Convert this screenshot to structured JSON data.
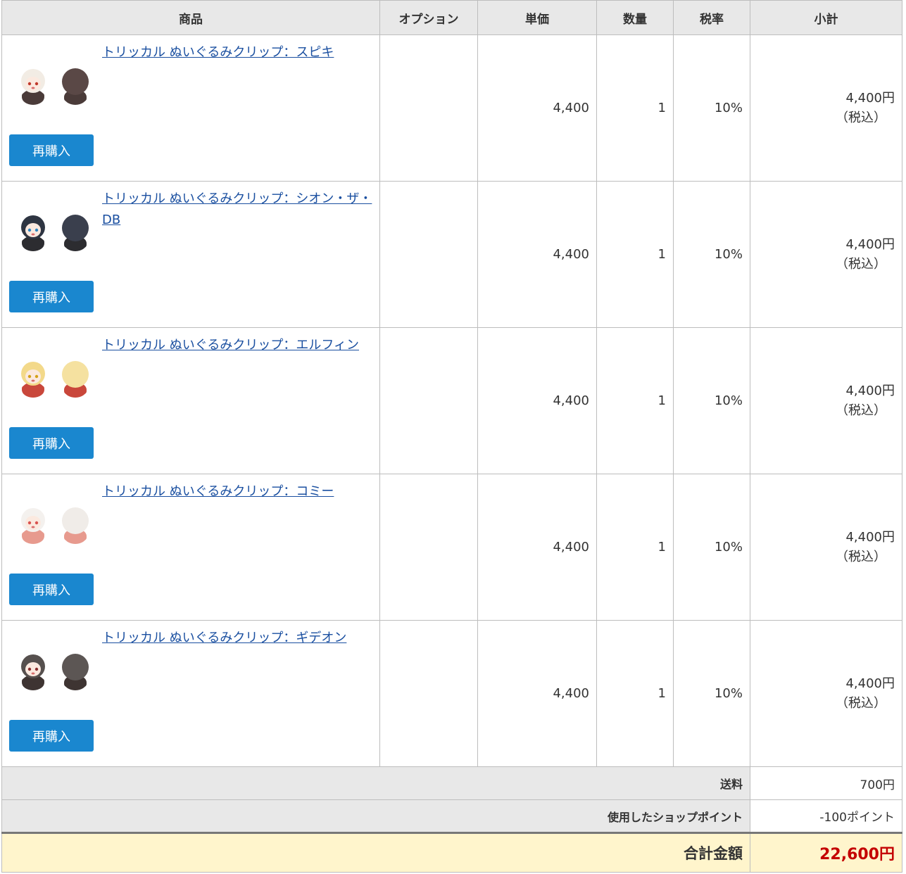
{
  "headers": {
    "product": "商品",
    "option": "オプション",
    "unit_price": "単価",
    "quantity": "数量",
    "tax_rate": "税率",
    "subtotal": "小計"
  },
  "rebuy_label": "再購入",
  "tax_included_label": "（税込）",
  "items": [
    {
      "name": "トリッカル ぬいぐるみクリップ：スピキ",
      "option": "",
      "unit_price": "4,400",
      "quantity": "1",
      "tax_rate": "10%",
      "subtotal": "4,400円"
    },
    {
      "name": "トリッカル ぬいぐるみクリップ：シオン・ザ・DB",
      "option": "",
      "unit_price": "4,400",
      "quantity": "1",
      "tax_rate": "10%",
      "subtotal": "4,400円"
    },
    {
      "name": "トリッカル ぬいぐるみクリップ：エルフィン",
      "option": "",
      "unit_price": "4,400",
      "quantity": "1",
      "tax_rate": "10%",
      "subtotal": "4,400円"
    },
    {
      "name": "トリッカル ぬいぐるみクリップ：コミー",
      "option": "",
      "unit_price": "4,400",
      "quantity": "1",
      "tax_rate": "10%",
      "subtotal": "4,400円"
    },
    {
      "name": "トリッカル ぬいぐるみクリップ：ギデオン",
      "option": "",
      "unit_price": "4,400",
      "quantity": "1",
      "tax_rate": "10%",
      "subtotal": "4,400円"
    }
  ],
  "summary": {
    "shipping_label": "送料",
    "shipping_value": "700円",
    "points_label": "使用したショップポイント",
    "points_value": "-100ポイント",
    "total_label": "合計金額",
    "total_value": "22,600円"
  },
  "colors": {
    "header_bg": "#e8e8e8",
    "link": "#1a4fa0",
    "button": "#1a87cf",
    "total_bg": "#fff5cc",
    "total_value": "#c40000"
  },
  "thumbnail_palettes": [
    {
      "hair": "#f2ece4",
      "outfit": "#4a3b39",
      "back": "#5a4846",
      "accent": "#c0392b"
    },
    {
      "hair": "#2e3542",
      "outfit": "#2c2c30",
      "back": "#3a3f4d",
      "accent": "#2e86c1"
    },
    {
      "hair": "#f3d98a",
      "outfit": "#c9473b",
      "back": "#f5e1a0",
      "accent": "#d4a017"
    },
    {
      "hair": "#f4f1ee",
      "outfit": "#e79a8e",
      "back": "#f0ece8",
      "accent": "#d9534f"
    },
    {
      "hair": "#56504e",
      "outfit": "#3e3432",
      "back": "#5c5654",
      "accent": "#8a2d2d"
    }
  ]
}
